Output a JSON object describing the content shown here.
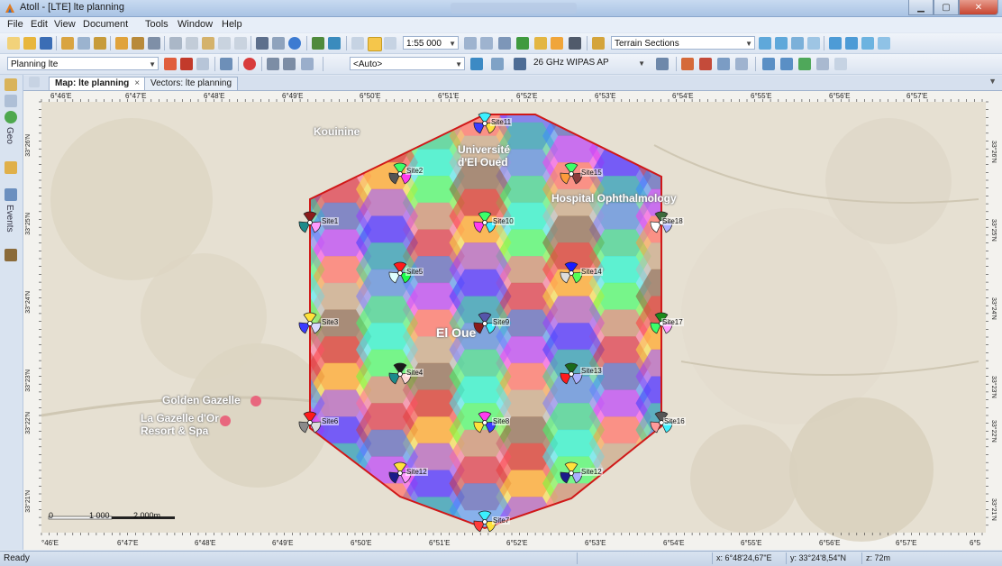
{
  "window": {
    "title": "Atoll - [LTE] lte planning"
  },
  "menu": [
    "File",
    "Edit",
    "View",
    "Document",
    "Tools",
    "Window",
    "Help"
  ],
  "toolbar": {
    "scale": "1:55 000",
    "terrain": "Terrain Sections",
    "planning": "Planning lte",
    "auto": "<Auto>",
    "wipas": "26 GHz WIPAS AP"
  },
  "dock": {
    "geo": "Geo",
    "events": "Events"
  },
  "tabs": [
    {
      "label": "Map: lte planning"
    },
    {
      "label": "Vectors: lte planning"
    }
  ],
  "axis": {
    "top": [
      "6°46'E",
      "6°47'E",
      "6°48'E",
      "6°49'E",
      "6°50'E",
      "6°51'E",
      "6°52'E",
      "6°53'E",
      "6°54'E",
      "6°55'E",
      "6°56'E",
      "6°57'E"
    ],
    "bottom": [
      "°46'E",
      "6°47'E",
      "6°48'E",
      "6°49'E",
      "6°50'E",
      "6°51'E",
      "6°52'E",
      "6°53'E",
      "6°54'E",
      "6°55'E",
      "6°56'E",
      "6°57'E",
      "6°5"
    ],
    "left": [
      "33°26'N",
      "33°25'N",
      "33°24'N",
      "33°23'N",
      "33°22'N",
      "33°21'N"
    ],
    "right": [
      "33°26'N",
      "33°25'N",
      "33°24'N",
      "33°23'N",
      "33°22'N",
      "33°21'N"
    ]
  },
  "places": {
    "kouinine": "Kouinine",
    "universite": "Université d'El Oued",
    "hospital": "Hospital Ophthalmology",
    "golden": "Golden Gazelle",
    "lagazelle": "La Gazelle d'Or Resort & Spa",
    "elqued": "El Oue"
  },
  "sites": [
    "Site11",
    "Site2",
    "Site15",
    "Site1",
    "Site10",
    "Site18",
    "Site5",
    "Site14",
    "Site3",
    "Site9",
    "Site17",
    "Site4",
    "Site13",
    "Site8",
    "Site6",
    "Site16",
    "Site12",
    "Site12",
    "Site7"
  ],
  "scale": {
    "zero": "0",
    "mid": "1 000",
    "end": "2 000m"
  },
  "status": {
    "ready": "Ready",
    "x": "x: 6°48'24,67\"E",
    "y": "y: 33°24'8,54\"N",
    "z": "z: 72m"
  }
}
